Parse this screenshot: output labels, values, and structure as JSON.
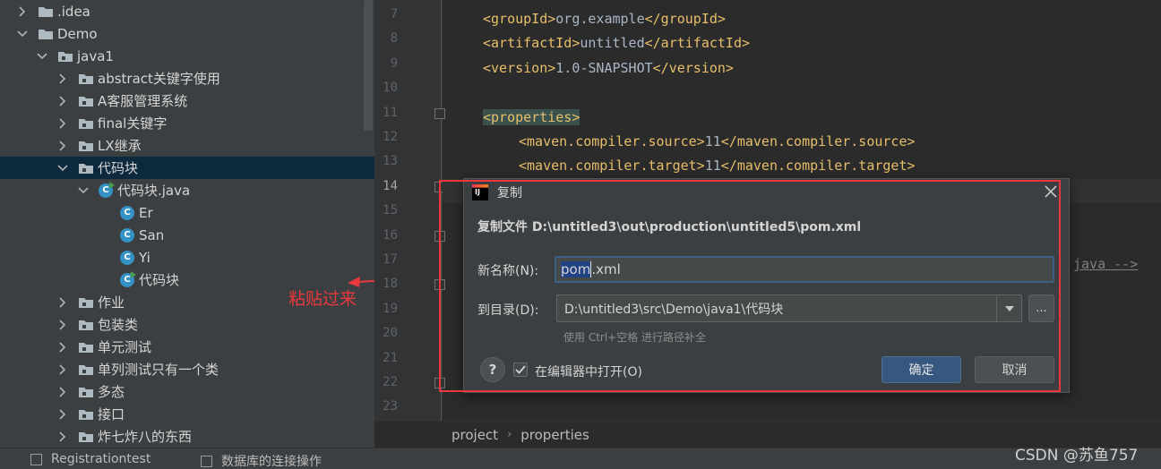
{
  "tree": {
    "items": [
      {
        "label": ".idea",
        "kind": "folder",
        "expanded": false,
        "depth": 1
      },
      {
        "label": "Demo",
        "kind": "folder",
        "expanded": true,
        "depth": 1
      },
      {
        "label": "java1",
        "kind": "package",
        "expanded": true,
        "depth": 2
      },
      {
        "label": "abstract关键字使用",
        "kind": "package",
        "expanded": false,
        "depth": 3
      },
      {
        "label": "A客服管理系统",
        "kind": "package",
        "expanded": false,
        "depth": 3
      },
      {
        "label": "final关键字",
        "kind": "package",
        "expanded": false,
        "depth": 3
      },
      {
        "label": "LX继承",
        "kind": "package",
        "expanded": false,
        "depth": 3
      },
      {
        "label": "代码块",
        "kind": "package",
        "expanded": true,
        "depth": 3,
        "selected": true
      },
      {
        "label": "代码块.java",
        "kind": "javafile",
        "expanded": true,
        "depth": 4
      },
      {
        "label": "Er",
        "kind": "class",
        "depth": 5
      },
      {
        "label": "San",
        "kind": "class",
        "depth": 5
      },
      {
        "label": "Yi",
        "kind": "class",
        "depth": 5
      },
      {
        "label": "代码块",
        "kind": "runclass",
        "depth": 5
      },
      {
        "label": "作业",
        "kind": "package",
        "expanded": false,
        "depth": 3
      },
      {
        "label": "包装类",
        "kind": "package",
        "expanded": false,
        "depth": 3
      },
      {
        "label": "单元测试",
        "kind": "package",
        "expanded": false,
        "depth": 3
      },
      {
        "label": "单列测试只有一个类",
        "kind": "package",
        "expanded": false,
        "depth": 3
      },
      {
        "label": "多态",
        "kind": "package",
        "expanded": false,
        "depth": 3
      },
      {
        "label": "接口",
        "kind": "package",
        "expanded": false,
        "depth": 3
      },
      {
        "label": "炸七炸八的东西",
        "kind": "package",
        "expanded": false,
        "depth": 3
      }
    ]
  },
  "annotation": {
    "text": "粘贴过来",
    "color": "#e8383d"
  },
  "editor": {
    "line_numbers": [
      "7",
      "8",
      "9",
      "10",
      "11",
      "12",
      "13",
      "14",
      "15",
      "16",
      "17",
      "18",
      "19",
      "20",
      "21",
      "22",
      "23"
    ],
    "current_line": "14",
    "lines": {
      "l7": {
        "open": "<groupId>",
        "text": "org.example",
        "close": "</groupId>"
      },
      "l8": {
        "open": "<artifactId>",
        "text": "untitled",
        "close": "</artifactId>"
      },
      "l9": {
        "open": "<version>",
        "text": "1.0-SNAPSHOT",
        "close": "</version>"
      },
      "l11": {
        "open": "<properties>"
      },
      "l12": {
        "open": "<maven.compiler.source>",
        "text": "11",
        "close": "</maven.compiler.source>"
      },
      "l13": {
        "open": "<maven.compiler.target>",
        "text": "11",
        "close": "</maven.compiler.target>"
      },
      "l17_fragment": "java -->"
    },
    "breadcrumb": [
      "project",
      "properties"
    ]
  },
  "bottom_tabs": [
    "Registrationtest",
    "数据库的连接操作"
  ],
  "watermark": "CSDN @苏鱼757",
  "dialog": {
    "title": "复制",
    "heading": "复制文件 D:\\untitled3\\out\\production\\untitled5\\pom.xml",
    "name_label": "新名称(N):",
    "name_value_selected": "pom",
    "name_value_rest": ".xml",
    "dir_label": "到目录(D):",
    "dir_value": "D:\\untitled3\\src\\Demo\\java1\\代码块",
    "browse_label": "...",
    "hint": "使用 Ctrl+空格 进行路径补全",
    "help_label": "?",
    "open_in_editor_label": "在编辑器中打开(O)",
    "open_in_editor_checked": true,
    "ok_label": "确定",
    "cancel_label": "取消",
    "accent": "#365880",
    "highlight_border": "#e8383d"
  }
}
